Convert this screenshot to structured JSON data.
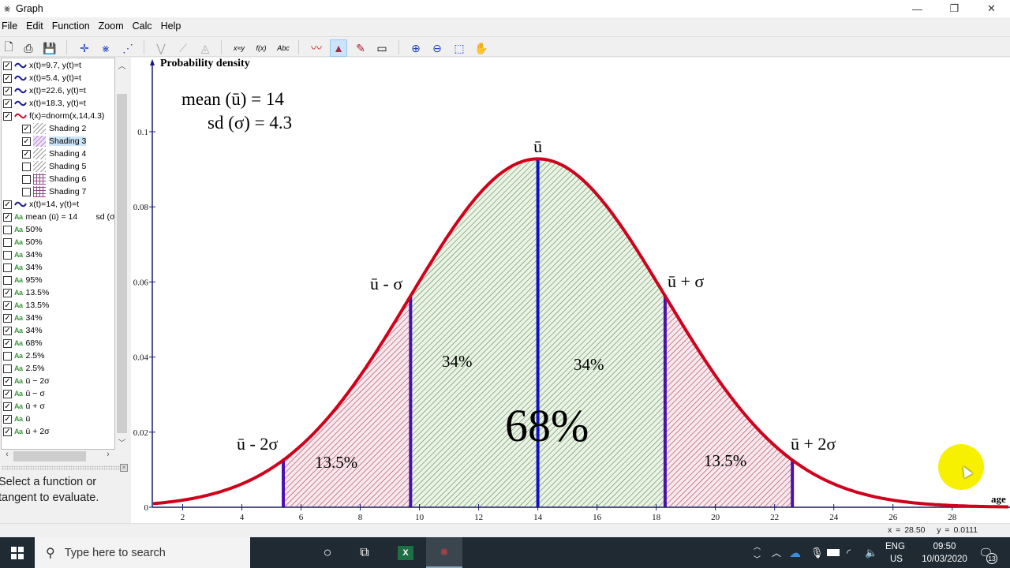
{
  "window": {
    "title": "Graph",
    "app_icon": "graph-app-icon",
    "controls": {
      "minimize": "—",
      "restore": "❐",
      "close": "✕"
    }
  },
  "menu": [
    "File",
    "Edit",
    "Function",
    "Zoom",
    "Calc",
    "Help"
  ],
  "toolbar": {
    "buttons": [
      {
        "name": "new-icon",
        "glyph": "🗋"
      },
      {
        "name": "print-icon",
        "glyph": "⎙"
      },
      {
        "name": "save-icon",
        "glyph": "💾"
      },
      {
        "name": "axes-icon",
        "glyph": "✛"
      },
      {
        "name": "insert-function-icon",
        "glyph": "⨳"
      },
      {
        "name": "insert-point-series-icon",
        "glyph": "⋰"
      },
      {
        "name": "tangent-icon",
        "glyph": "⋁"
      },
      {
        "name": "relation-icon",
        "glyph": "⟋"
      },
      {
        "name": "shading-icon",
        "glyph": "◬"
      },
      {
        "name": "trendline-icon",
        "glyph": "x≈y"
      },
      {
        "name": "evaluate-icon",
        "glyph": "f(x)"
      },
      {
        "name": "label-icon",
        "glyph": "Abc"
      },
      {
        "name": "insert-line-icon",
        "glyph": "〰"
      },
      {
        "name": "insert-shade-icon",
        "glyph": "▲",
        "active": true
      },
      {
        "name": "insert-relation-icon",
        "glyph": "✎"
      },
      {
        "name": "window-icon",
        "glyph": "▭"
      },
      {
        "name": "zoom-in-icon",
        "glyph": "⊕"
      },
      {
        "name": "zoom-out-icon",
        "glyph": "⊖"
      },
      {
        "name": "zoom-square-icon",
        "glyph": "⬚"
      },
      {
        "name": "hand-pan-icon",
        "glyph": "✋"
      }
    ]
  },
  "function_list": [
    {
      "type": "param",
      "checked": true,
      "label": "x(t)=9.7, y(t)=t",
      "color": "#1a1a9a",
      "indent": 0
    },
    {
      "type": "param",
      "checked": true,
      "label": "x(t)=5.4, y(t)=t",
      "color": "#1a1a9a",
      "indent": 0
    },
    {
      "type": "param",
      "checked": true,
      "label": "x(t)=22.6, y(t)=t",
      "color": "#1a1a9a",
      "indent": 0
    },
    {
      "type": "param",
      "checked": true,
      "label": "x(t)=18.3, y(t)=t",
      "color": "#1a1a9a",
      "indent": 0
    },
    {
      "type": "func",
      "checked": true,
      "label": "f(x)=dnorm(x,14,4.3)",
      "color": "#c8102e",
      "indent": 0
    },
    {
      "type": "shade",
      "checked": true,
      "label": "Shading 2",
      "pattern": "hatch",
      "indent": 1
    },
    {
      "type": "shade",
      "checked": true,
      "label": "Shading 3",
      "pattern": "hatch-purple",
      "indent": 1,
      "selected": true
    },
    {
      "type": "shade",
      "checked": true,
      "label": "Shading 4",
      "pattern": "hatch",
      "indent": 1
    },
    {
      "type": "shade",
      "checked": false,
      "label": "Shading 5",
      "pattern": "hatch",
      "indent": 1
    },
    {
      "type": "shade",
      "checked": false,
      "label": "Shading 6",
      "pattern": "grid",
      "indent": 1
    },
    {
      "type": "shade",
      "checked": false,
      "label": "Shading 7",
      "pattern": "grid",
      "indent": 1
    },
    {
      "type": "param",
      "checked": true,
      "label": "x(t)=14, y(t)=t",
      "color": "#1a1a9a",
      "indent": 0
    },
    {
      "type": "label",
      "checked": true,
      "label": "mean (ū) = 14        sd (σ",
      "indent": 0
    },
    {
      "type": "label",
      "checked": false,
      "label": "50%",
      "indent": 0
    },
    {
      "type": "label",
      "checked": false,
      "label": "50%",
      "indent": 0
    },
    {
      "type": "label",
      "checked": false,
      "label": "34%",
      "indent": 0
    },
    {
      "type": "label",
      "checked": false,
      "label": "34%",
      "indent": 0
    },
    {
      "type": "label",
      "checked": false,
      "label": "95%",
      "indent": 0
    },
    {
      "type": "label",
      "checked": true,
      "label": "13.5%",
      "indent": 0
    },
    {
      "type": "label",
      "checked": true,
      "label": "13.5%",
      "indent": 0
    },
    {
      "type": "label",
      "checked": true,
      "label": "34%",
      "indent": 0
    },
    {
      "type": "label",
      "checked": true,
      "label": "34%",
      "indent": 0
    },
    {
      "type": "label",
      "checked": true,
      "label": "68%",
      "indent": 0
    },
    {
      "type": "label",
      "checked": false,
      "label": "2.5%",
      "indent": 0
    },
    {
      "type": "label",
      "checked": false,
      "label": "2.5%",
      "indent": 0
    },
    {
      "type": "label",
      "checked": true,
      "label": "ū − 2σ",
      "indent": 0
    },
    {
      "type": "label",
      "checked": true,
      "label": "ū − σ",
      "indent": 0
    },
    {
      "type": "label",
      "checked": true,
      "label": "ū + σ",
      "indent": 0
    },
    {
      "type": "label",
      "checked": true,
      "label": "ū",
      "indent": 0
    },
    {
      "type": "label",
      "checked": true,
      "label": "ū + 2σ",
      "indent": 0
    }
  ],
  "label_icon_text": "Aa",
  "eval_panel": {
    "message": "Select a function or tangent to evaluate."
  },
  "status": {
    "x_readout": "x = 28.50",
    "y_readout": "y = 0.0111"
  },
  "chart_data": {
    "type": "area",
    "function": "dnorm(x, 14, 4.3)",
    "mean": 14,
    "sd": 4.3,
    "xlabel": "age",
    "ylabel": "Probability density",
    "xlim": [
      1,
      29.9
    ],
    "ylim": [
      0,
      0.1
    ],
    "xticks": [
      2,
      4,
      6,
      8,
      10,
      12,
      14,
      16,
      18,
      20,
      22,
      24,
      26,
      28
    ],
    "yticks": [
      0,
      0.02,
      0.04,
      0.06,
      0.08,
      0.1
    ],
    "ytick_labels": [
      "0",
      "0.02",
      "0.04",
      "0.06",
      "0.08",
      "0.1"
    ],
    "vertical_lines": [
      5.4,
      9.7,
      14,
      18.3,
      22.6
    ],
    "shaded_regions": [
      {
        "from": 5.4,
        "to": 9.7,
        "color": "#b03050",
        "label": "13.5%"
      },
      {
        "from": 9.7,
        "to": 18.3,
        "color": "#4a8a3a",
        "label": "34% / 34%"
      },
      {
        "from": 18.3,
        "to": 22.6,
        "color": "#b03050",
        "label": "13.5%"
      }
    ],
    "annotations": {
      "mean_text": "mean (ū) = 14",
      "sd_text": "sd (σ) = 4.3",
      "mu": "ū",
      "mu_minus_sigma": "ū - σ",
      "mu_plus_sigma": "ū + σ",
      "mu_minus_2sigma": "ū - 2σ",
      "mu_plus_2sigma": "ū + 2σ",
      "left_tail_pct": "13.5%",
      "left_center_pct": "34%",
      "right_center_pct": "34%",
      "right_tail_pct": "13.5%",
      "center_total_pct": "68%"
    },
    "curve_color": "#d0021b",
    "line_color": "#1010c8",
    "axis_color": "#1a1a7a"
  },
  "taskbar": {
    "search_placeholder": "Type here to search",
    "language": "ENG",
    "region": "US",
    "time": "09:50",
    "date": "10/03/2020",
    "notification_count": "13"
  }
}
